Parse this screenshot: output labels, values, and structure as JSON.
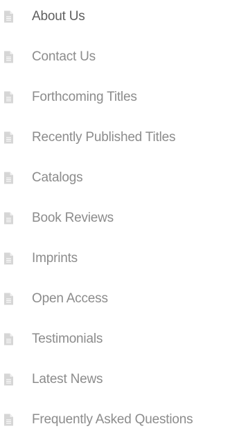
{
  "menu": {
    "icon": "document-icon",
    "icon_color": "#d6d6d6",
    "text_color": "#8c8c8c",
    "items": [
      {
        "label": "About Us"
      },
      {
        "label": "Contact Us"
      },
      {
        "label": "Forthcoming Titles"
      },
      {
        "label": "Recently Published Titles"
      },
      {
        "label": "Catalogs"
      },
      {
        "label": "Book Reviews"
      },
      {
        "label": "Imprints"
      },
      {
        "label": "Open Access"
      },
      {
        "label": "Testimonials"
      },
      {
        "label": "Latest News"
      },
      {
        "label": "Frequently Asked Questions"
      }
    ]
  }
}
